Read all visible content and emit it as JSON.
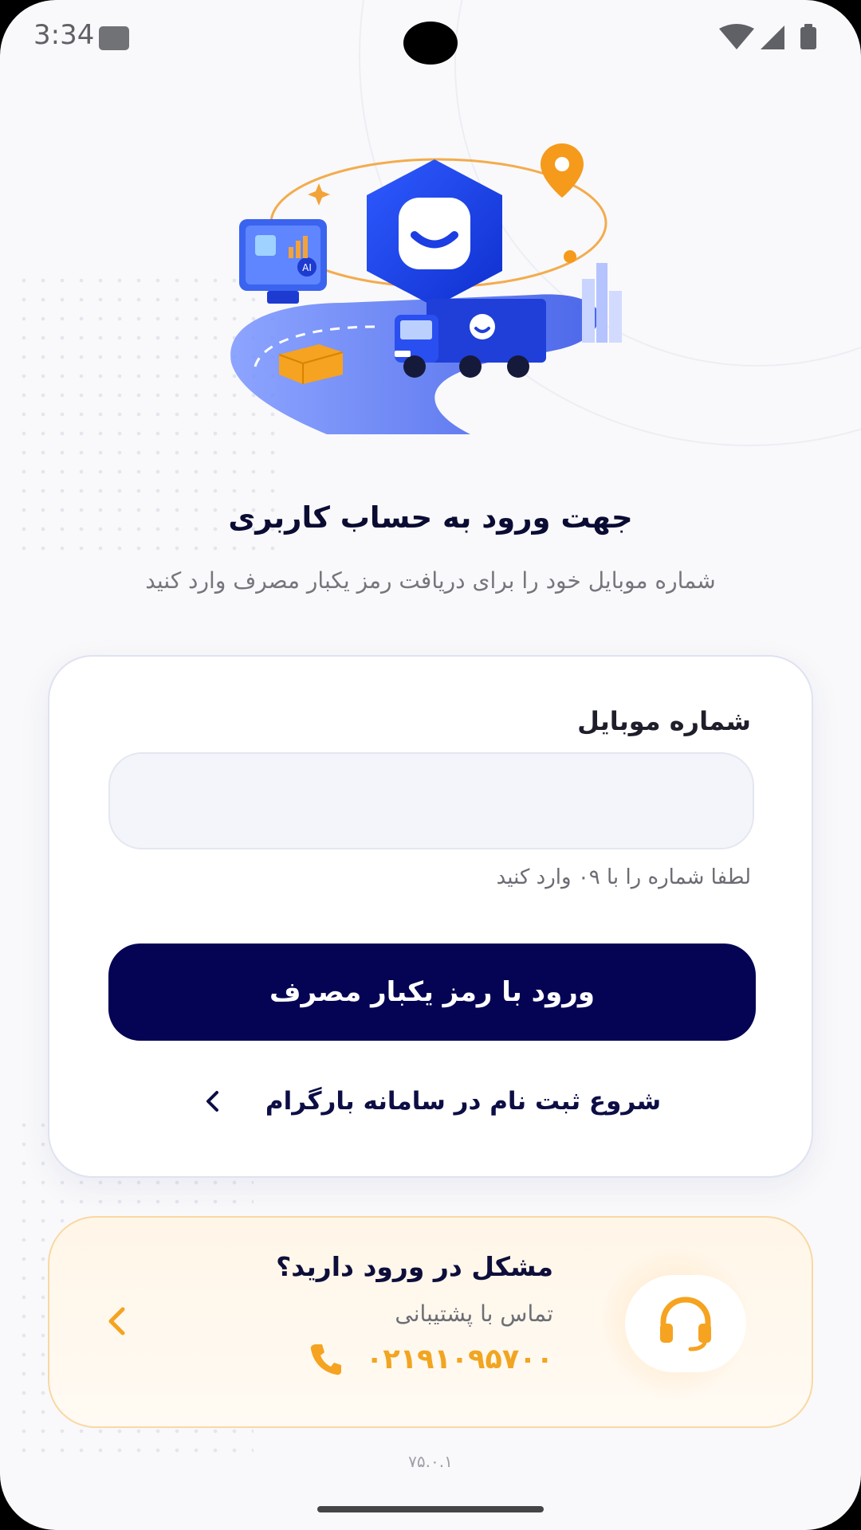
{
  "status_bar": {
    "time": "3:34",
    "icons": [
      "wifi-icon",
      "signal-icon",
      "battery-icon"
    ]
  },
  "hero": {
    "description_icon": "truck-illustration"
  },
  "header": {
    "title": "جهت ورود به حساب کاربری",
    "subtitle": "شماره موبایل خود را برای دریافت رمز یکبار مصرف وارد کنید"
  },
  "login": {
    "field_label": "شماره موبایل",
    "phone_value": "",
    "phone_placeholder": "",
    "hint": "لطفا شماره را با ۰۹ وارد کنید",
    "submit_label": "ورود با رمز یکبار مصرف",
    "register_label": "شروع ثبت نام در سامانه بارگرام"
  },
  "support": {
    "title": "مشکل در ورود دارید؟",
    "subtitle": "تماس با پشتیبانی",
    "phone": "۰۲۱۹۱۰۹۵۷۰۰"
  },
  "footer": {
    "version": "۷۵.۰.۱"
  },
  "colors": {
    "primary": "#050454",
    "accent": "#f1a520",
    "support_bg": "#fff6e8"
  }
}
